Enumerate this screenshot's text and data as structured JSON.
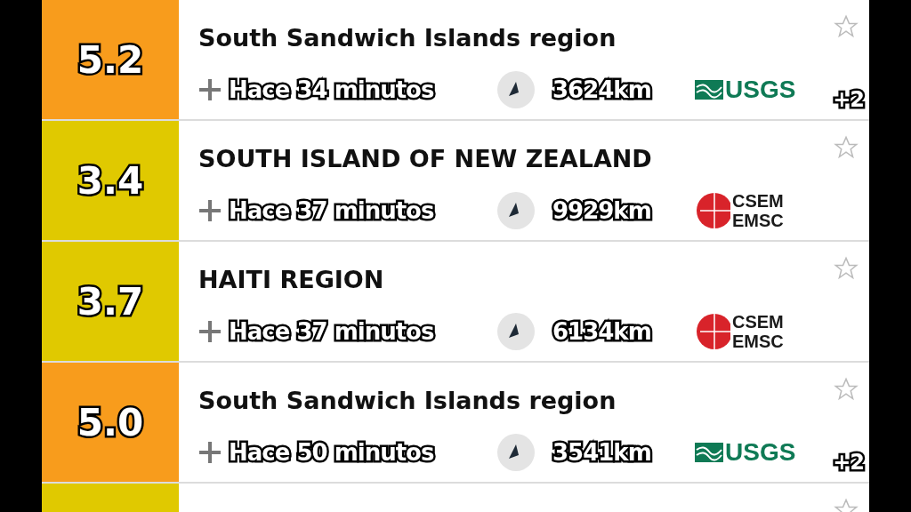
{
  "quakes": [
    {
      "magnitude": "5.2",
      "color": "#f89c1c",
      "place": "South Sandwich Islands region",
      "time": "Hace 34 minutos",
      "distance": "3624km",
      "source": {
        "kind": "usgs",
        "lines": [
          "USGS"
        ]
      },
      "extra": "+2",
      "starred": false
    },
    {
      "magnitude": "3.4",
      "color": "#e0c900",
      "place": "SOUTH ISLAND OF NEW ZEALAND",
      "time": "Hace 37 minutos",
      "distance": "9929km",
      "source": {
        "kind": "emsc",
        "lines": [
          "CSEM",
          "EMSC"
        ]
      },
      "starred": false
    },
    {
      "magnitude": "3.7",
      "color": "#e0c900",
      "place": "HAITI REGION",
      "time": "Hace 37 minutos",
      "distance": "6134km",
      "source": {
        "kind": "emsc",
        "lines": [
          "CSEM",
          "EMSC"
        ]
      },
      "starred": false
    },
    {
      "magnitude": "5.0",
      "color": "#f89c1c",
      "place": "South Sandwich Islands region",
      "time": "Hace 50 minutos",
      "distance": "3541km",
      "source": {
        "kind": "usgs",
        "lines": [
          "USGS"
        ]
      },
      "extra": "+2",
      "starred": false
    },
    {
      "color": "#e0c900",
      "starred": false
    }
  ]
}
